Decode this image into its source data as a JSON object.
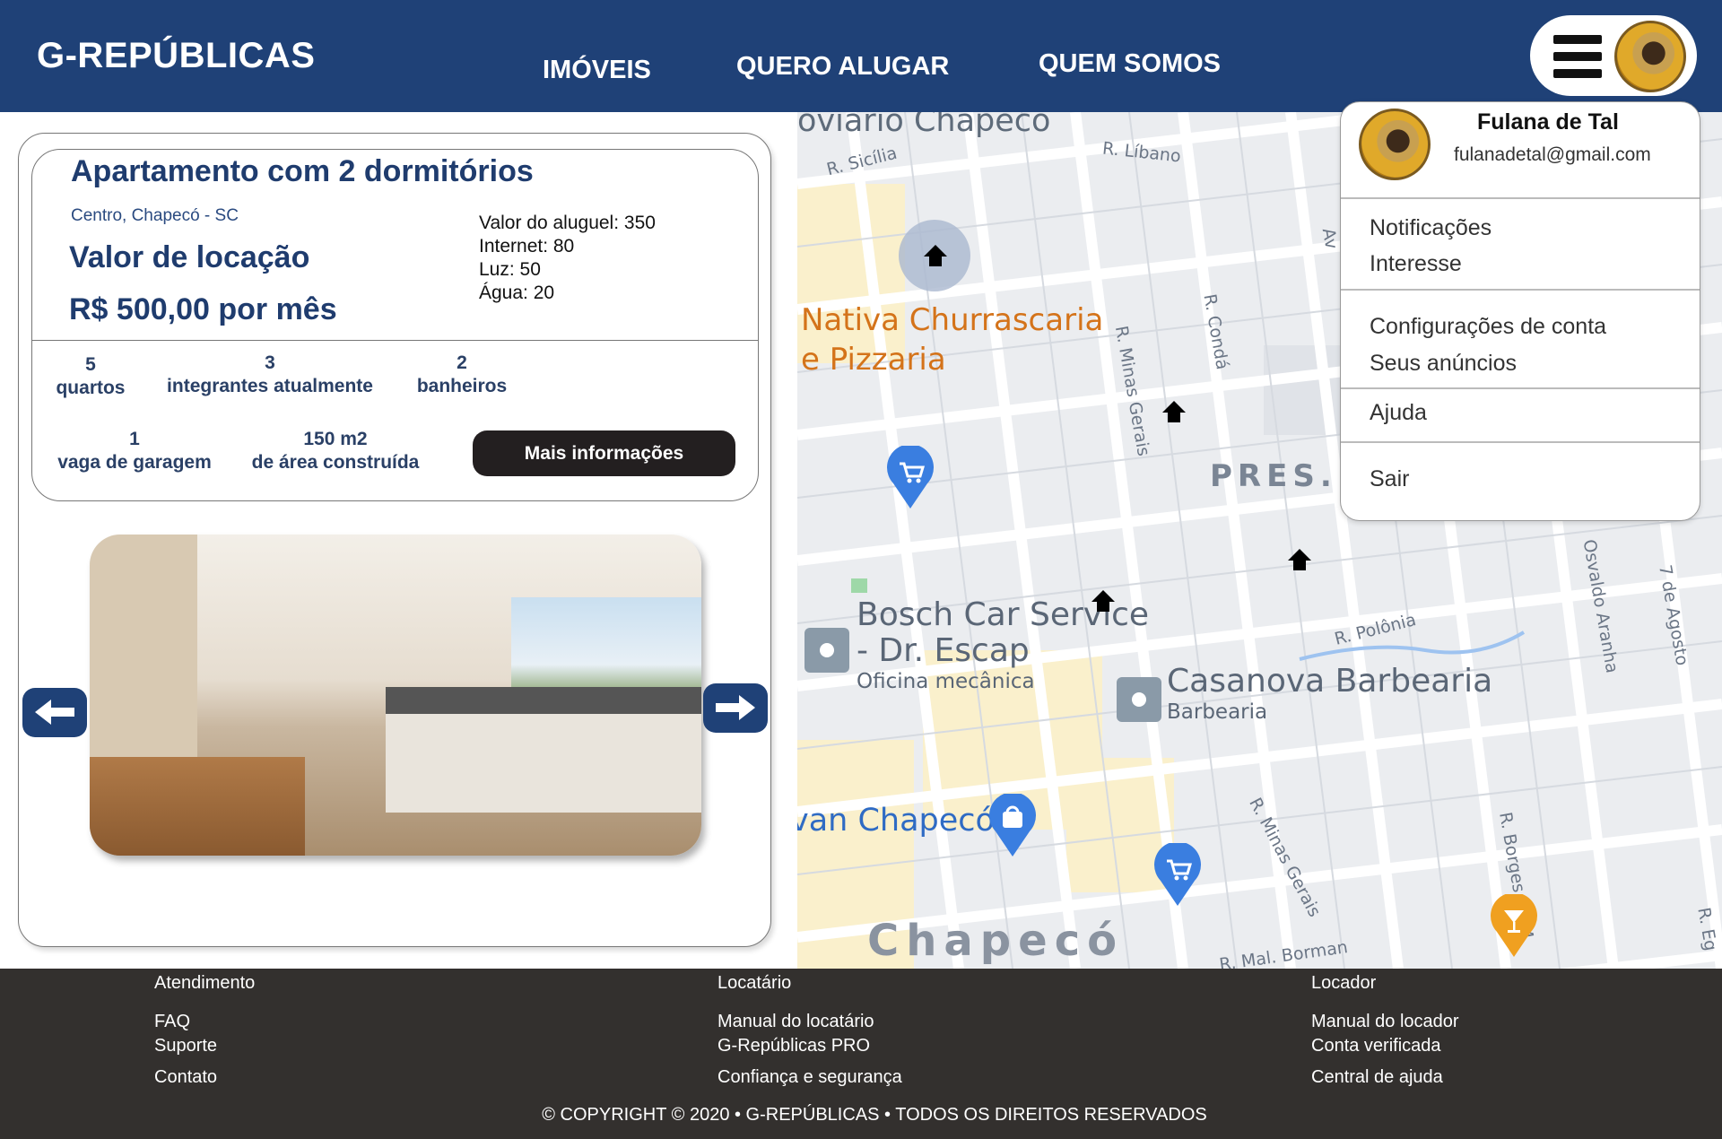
{
  "header": {
    "logo": "G-REPÚBLICAS",
    "nav": [
      "IMÓVEIS",
      "QUERO ALUGAR",
      "QUEM SOMOS"
    ],
    "icons": {
      "menu": "hamburger-menu-icon",
      "avatar": "user-avatar"
    },
    "colors": {
      "background": "#1f4177",
      "text": "#ffffff"
    }
  },
  "listing": {
    "title": "Apartamento com 2 dormitórios",
    "location": "Centro, Chapecó - SC",
    "rent_label": "Valor de locação",
    "price": "R$ 500,00 por mês",
    "breakdown": [
      "Valor do aluguel: 350",
      "Internet: 80",
      "Luz: 50",
      "Água: 20"
    ],
    "stats": [
      {
        "value": "5",
        "label": "quartos"
      },
      {
        "value": "3",
        "label": "integrantes atualmente"
      },
      {
        "value": "2",
        "label": "banheiros"
      },
      {
        "value": "1",
        "label": "vaga de garagem"
      },
      {
        "value": "150 m2",
        "label": "de área construída"
      }
    ],
    "more_button": "Mais informações",
    "gallery": {
      "prev_icon": "arrow-left-icon",
      "next_icon": "arrow-right-icon"
    }
  },
  "map": {
    "labels": {
      "rodoviario": "oviário Chapecó",
      "r_sicilia": "R. Sicília",
      "r_libano": "R. Líbano",
      "nativa_1": "Nativa Churrascaria",
      "nativa_2": "e Pizzaria",
      "r_minas_gerais": "R. Minas Gerais",
      "r_conda": "R. Condá",
      "pres": "PRES.",
      "bosch_1": "Bosch Car Service",
      "bosch_2": "- Dr. Escap",
      "bosch_3": "Oficina mecânica",
      "r_polonia": "R. Polônia",
      "casanova_1": "Casanova Barbearia",
      "casanova_2": "Barbearia",
      "chapeco_shop": "van Chapecó",
      "r_minas_gerais_2": "R. Minas Gerais",
      "r_borges": "R. Borges de M",
      "r_mal_borman": "R. Mal. Borman",
      "chapeco": "Chapecó",
      "osvaldo_aranha": "Osvaldo Aranha",
      "sete_agosto": "7 de Agosto",
      "av": "Av",
      "r_e": "R. Eg"
    },
    "pins": [
      "home-pin",
      "cart-pin",
      "shopping-bag-pin",
      "cart-pin",
      "cocktail-pin",
      "service-pin",
      "service-pin"
    ]
  },
  "dropdown": {
    "name": "Fulana de Tal",
    "email": "fulanadetal@gmail.com",
    "groups": [
      [
        "Notificações",
        "Interesse"
      ],
      [
        "Configurações de conta",
        "Seus anúncios"
      ],
      [
        "Ajuda"
      ],
      [
        "Sair"
      ]
    ]
  },
  "footer": {
    "columns": [
      {
        "heading": "Atendimento",
        "links": [
          "FAQ",
          "Suporte",
          "Contato"
        ]
      },
      {
        "heading": "Locatário",
        "links": [
          "Manual do locatário",
          "G-Repúblicas PRO",
          "Confiança e segurança"
        ]
      },
      {
        "heading": "Locador",
        "links": [
          "Manual do locador",
          "Conta verificada",
          "Central de ajuda"
        ]
      }
    ],
    "copyright": "© COPYRIGHT © 2020 • G-REPÚBLICAS • TODOS OS DIREITOS RESERVADOS",
    "colors": {
      "background": "#33302e"
    }
  }
}
